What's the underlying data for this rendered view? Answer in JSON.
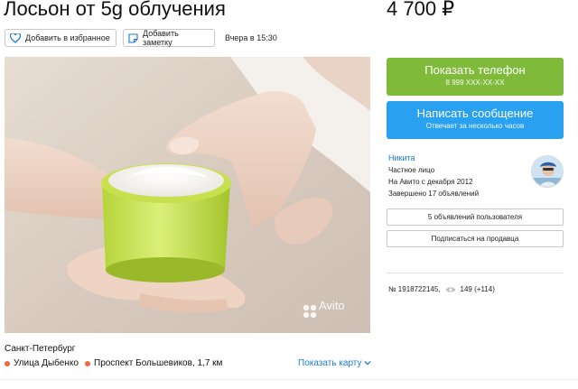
{
  "listing": {
    "title": "Лосьон от 5g облучения",
    "price": "4 700 ₽",
    "date": "Вчера в 15:30",
    "actions": {
      "favorite_label": "Добавить в избранное",
      "note_label": "Добавить заметку"
    },
    "image": {
      "watermark": "Avito"
    },
    "location": {
      "city": "Санкт-Петербург",
      "metro": [
        {
          "name": "Улица Дыбенко",
          "color": "#ef6a3a"
        },
        {
          "name": "Проспект Большевиков, 1,7 км",
          "color": "#ef6a3a"
        }
      ],
      "map_link": "Показать карту"
    }
  },
  "contact": {
    "phone_button": {
      "label": "Показать телефон",
      "sub": "8 999 XXX-XX-XX",
      "color": "#7fba3b"
    },
    "message_button": {
      "label": "Написать сообщение",
      "sub": "Отвечает за несколько часов",
      "color": "#2aa0f0"
    }
  },
  "seller": {
    "name": "Никита",
    "type": "Частное лицо",
    "since": "На Авито с декабря 2012",
    "completed": "Завершено 17 объявлений",
    "user_ads_button": "5 объявлений пользователя",
    "subscribe_button": "Подписаться на продавца"
  },
  "stats": {
    "ad_number": "№ 1918722145,",
    "views": "149 (+114)"
  },
  "icons": {
    "favorite": "heart-icon",
    "note": "note-icon",
    "views": "eye-icon",
    "map_toggle": "chevron-down-icon"
  }
}
